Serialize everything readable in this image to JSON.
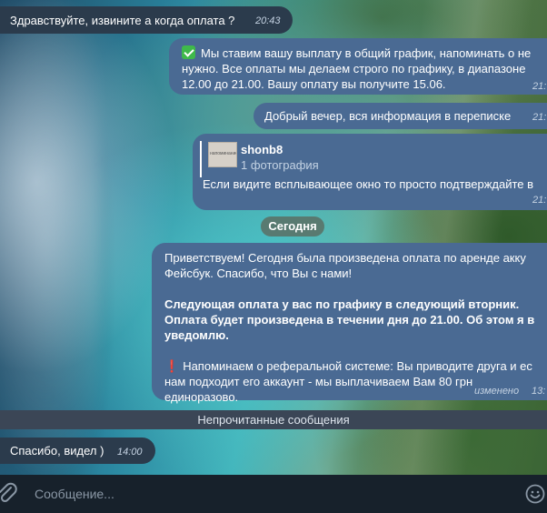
{
  "messages": [
    {
      "id": "m1",
      "direction": "incoming",
      "text": "Здравствуйте, извините а когда оплата ?",
      "time": "20:43"
    },
    {
      "id": "m2",
      "direction": "outgoing",
      "lines": [
        "Мы ставим вашу выплату в общий график, напоминать о не",
        "нужно. Все оплаты мы делаем строго по графику,  в диапазоне",
        "12.00 до 21.00. Вашу оплату вы получите 15.06."
      ],
      "time": "21:"
    },
    {
      "id": "m3",
      "direction": "outgoing",
      "text": "Добрый вечер, вся информация в переписке",
      "time": "21:"
    },
    {
      "id": "m4",
      "direction": "outgoing",
      "forward_author": "shonb8",
      "album_label": "1 фотография",
      "thumb_text": "напоминание от",
      "caption": "Если видите всплывающее окно то просто подтверждайте в",
      "time": "21:"
    },
    {
      "id": "m5",
      "direction": "outgoing",
      "para1": [
        "Приветствуем! Сегодня была произведена оплата по аренде акку",
        "Фейсбук. Спасибо, что Вы с нами!"
      ],
      "para2_bold": [
        "Следующая оплата у вас по графику в следующий вторник.",
        "Оплата будет произведена в течении дня до 21.00. Об этом я в",
        "уведомлю."
      ],
      "para3": [
        "Напоминаем о реферальной системе: Вы приводите друга и ес",
        "нам подходит его аккаунт - мы выплачиваем Вам 80 грн",
        "единоразово."
      ],
      "edited_label": "изменено",
      "time": "13:"
    },
    {
      "id": "m6",
      "direction": "incoming",
      "text": "Спасибо, видел )",
      "time": "14:00"
    }
  ],
  "date_separator": "Сегодня",
  "unread_separator": "Непрочитанные сообщения",
  "composer": {
    "placeholder": "Сообщение...",
    "attach_icon": "paperclip-icon",
    "emoji_icon": "emoji-icon"
  },
  "colors": {
    "outgoing_bubble": "#4a6a93",
    "incoming_bubble": "#2b3b4c",
    "composer_bg": "#17212b",
    "unread_bar": "#3b4656"
  }
}
